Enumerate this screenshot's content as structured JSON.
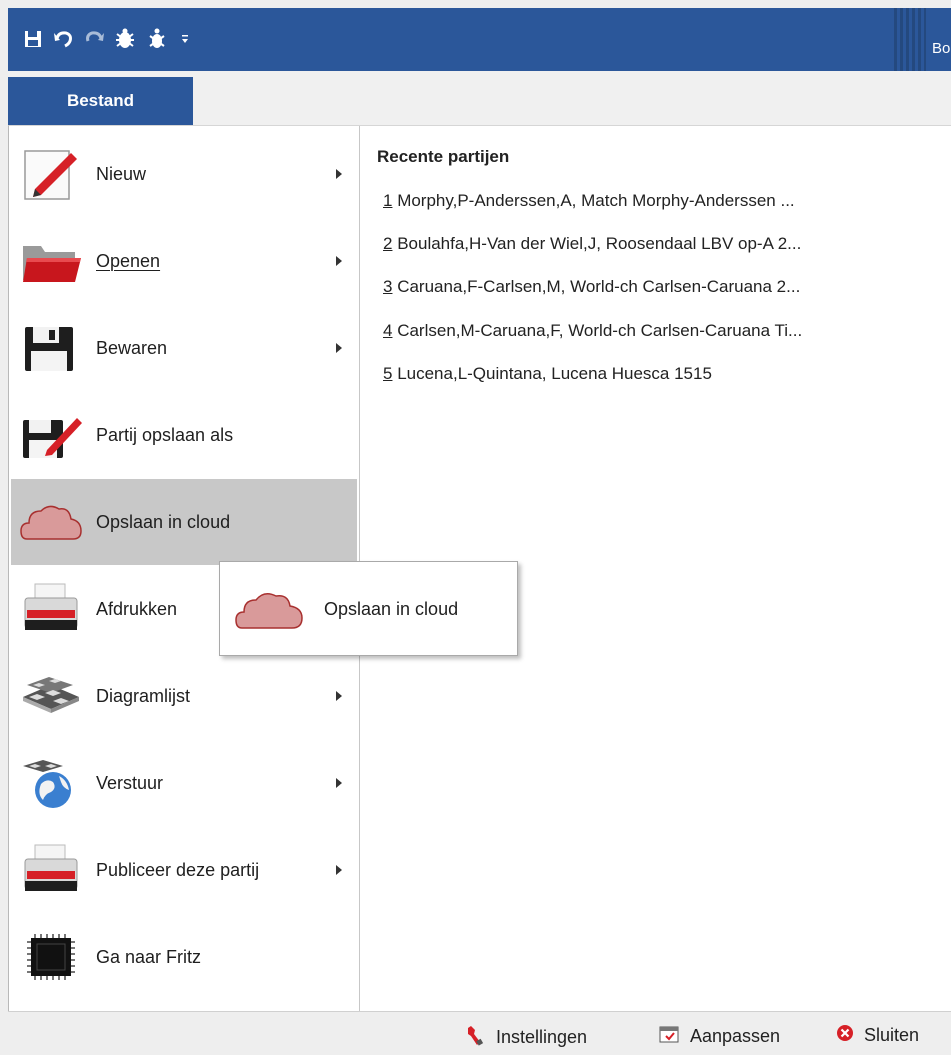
{
  "titlebar": {
    "title_fragment": "Bo",
    "qat_icons": [
      "save-icon",
      "undo-icon",
      "redo-icon",
      "engine-icon",
      "engine2-icon",
      "customize-dropdown-icon"
    ]
  },
  "tab": {
    "label": "Bestand"
  },
  "menu": {
    "items": [
      {
        "name": "nieuw",
        "label": "Nieuw",
        "icon": "new-pencil-icon",
        "submenu": true
      },
      {
        "name": "openen",
        "label": "Openen",
        "icon": "folder-open-icon",
        "submenu": true
      },
      {
        "name": "bewaren",
        "label": "Bewaren",
        "icon": "floppy-save-icon",
        "submenu": true
      },
      {
        "name": "partij-opslaan-als",
        "label": "Partij opslaan als",
        "icon": "save-as-icon",
        "submenu": false
      },
      {
        "name": "opslaan-in-cloud",
        "label": "Opslaan in cloud",
        "icon": "cloud-icon",
        "submenu": false
      },
      {
        "name": "afdrukken",
        "label": "Afdrukken",
        "icon": "printer-icon",
        "submenu": false
      },
      {
        "name": "diagramlijst",
        "label": "Diagramlijst",
        "icon": "chessboards-icon",
        "submenu": true
      },
      {
        "name": "verstuur",
        "label": "Verstuur",
        "icon": "globe-icon",
        "submenu": true
      },
      {
        "name": "publiceer",
        "label": "Publiceer deze partij",
        "icon": "printer-icon",
        "submenu": true
      },
      {
        "name": "ga-naar-fritz",
        "label": "Ga naar Fritz",
        "icon": "chip-icon",
        "submenu": false
      }
    ],
    "active": "Opslaan in cloud"
  },
  "recent": {
    "title": "Recente partijen",
    "items": [
      {
        "num": "1",
        "text": " Morphy,P-Anderssen,A, Match Morphy-Anderssen ..."
      },
      {
        "num": "2",
        "text": " Boulahfa,H-Van der Wiel,J, Roosendaal LBV op-A 2..."
      },
      {
        "num": "3",
        "text": " Caruana,F-Carlsen,M, World-ch Carlsen-Caruana 2..."
      },
      {
        "num": "4",
        "text": " Carlsen,M-Caruana,F, World-ch Carlsen-Caruana Ti..."
      },
      {
        "num": "5",
        "text": " Lucena,L-Quintana, Lucena Huesca 1515"
      }
    ]
  },
  "tooltip": {
    "label": "Opslaan in cloud",
    "icon": "cloud-icon"
  },
  "statusbar": {
    "instellingen": "Instellingen",
    "aanpassen": "Aanpassen",
    "sluiten": "Sluiten"
  },
  "colors": {
    "titlebar": "#2b579a",
    "active_item": "#c8c8c8",
    "cloud_fill": "#d99a9a",
    "cloud_stroke": "#a8302f"
  }
}
